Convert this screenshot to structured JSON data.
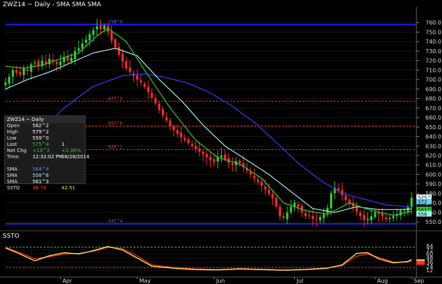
{
  "title": "ZWZ14 ~ Daily  -  SMA SMA SMA",
  "subpanel_title": "SSTO",
  "price_axis": {
    "ticks": [
      550,
      560,
      570,
      580,
      590,
      600,
      610,
      620,
      630,
      640,
      650,
      660,
      670,
      680,
      690,
      700,
      710,
      720,
      730,
      740,
      750,
      760
    ],
    "labels": [
      "550.0",
      "560.0",
      "570.0",
      "580.0",
      "590.0",
      "600.0",
      "610.0",
      "620.0",
      "630.0",
      "640.0",
      "650.0",
      "660.0",
      "670.0",
      "680.0",
      "690.0",
      "700.0",
      "710.0",
      "720.0",
      "730.0",
      "740.0",
      "750.0",
      "760.0"
    ]
  },
  "osc_axis": {
    "ticks": [
      12,
      24,
      36,
      48,
      60,
      72,
      84
    ],
    "labels": [
      "12",
      "24",
      "36",
      "48",
      "60",
      "72",
      "84"
    ]
  },
  "date_axis": {
    "labels": [
      "Apr",
      "May",
      "Jun",
      "Jul",
      "Aug",
      "Sep"
    ]
  },
  "levels": [
    {
      "value": 758,
      "label": "758^0",
      "color": "#1c1cff",
      "solid": true
    },
    {
      "value": 677.25,
      "label": "677^2",
      "color": "#ff2a2a",
      "solid": false
    },
    {
      "value": 651,
      "label": "651^6",
      "color": "#ff2a2a",
      "solid": false
    },
    {
      "value": 626.25,
      "label": "626^1",
      "color": "#ff2a2a",
      "solid": false
    },
    {
      "value": 548,
      "label": "547^4",
      "color": "#1c1cff",
      "solid": true
    }
  ],
  "price_tags": [
    {
      "label": "575^4",
      "value": 576,
      "bg": "#ffffff",
      "fg": "#000000"
    },
    {
      "label": "572",
      "value": 571.5,
      "bg": "#5ad7ff",
      "fg": "#000000"
    },
    {
      "label": "561^2",
      "value": 563,
      "bg": "#33cc33",
      "fg": "#000000"
    },
    {
      "label": "558",
      "value": 558.5,
      "bg": "#9ff3ef",
      "fg": "#000000"
    }
  ],
  "osc_levels": [
    {
      "value": 80,
      "color": "#33cc33"
    },
    {
      "value": 20,
      "color": "#ff2a2a"
    }
  ],
  "osc_tags": [
    {
      "label": "",
      "value": 38,
      "bg": "#ffe24a"
    },
    {
      "label": "",
      "value": 34,
      "bg": "#ff2a2a"
    }
  ],
  "info_box": {
    "header": "ZWZ14 ~ Daily",
    "rows": [
      {
        "label": "Open",
        "value": "562^2",
        "value_color": "w"
      },
      {
        "label": "High",
        "value": "579^2",
        "value_color": "w"
      },
      {
        "label": "Low",
        "value": "559^0",
        "value_color": "w"
      },
      {
        "label": "Last",
        "value": "575^4",
        "value_color": "g",
        "extra": "1",
        "extra_color": "w"
      },
      {
        "label": "Net Chg",
        "value": "+13^2",
        "value_color": "g",
        "extra": "+2.36%",
        "extra_color": "g"
      },
      {
        "label": "Time",
        "value": "12:32:02 PM",
        "value_color": "w",
        "extra": "08/28/2014",
        "extra_color": "w"
      },
      {
        "label": "",
        "value": "",
        "value_color": "w"
      },
      {
        "label": "SMA",
        "value": "564^4",
        "value_color": "b"
      },
      {
        "label": "SMA",
        "value": "558^6",
        "value_color": "cy"
      },
      {
        "label": "SMA",
        "value": "561^3",
        "value_color": "w"
      },
      {
        "label": "SSTO",
        "value": "38.79",
        "value_color": "r",
        "extra": "42.51",
        "extra_color": "y"
      }
    ]
  },
  "chart_data": {
    "type": "candlestick",
    "title": "ZWZ14 ~ Daily  -  SMA SMA SMA",
    "ylim": [
      545,
      770
    ],
    "colors": {
      "up": "#33cc33",
      "down": "#ff2a2a",
      "sma_fast": "#33cc33",
      "sma_mid": "#9ff3ef",
      "sma_slow": "#3a3aff",
      "ssto_k": "#ffe24a",
      "ssto_d": "#ff2a2a"
    },
    "month_positions": {
      "Apr": 15,
      "May": 36,
      "Jun": 57,
      "Jul": 79,
      "Aug": 101,
      "Sep": 123
    },
    "closes": [
      697,
      703,
      710,
      707,
      705,
      712,
      709,
      716,
      718,
      714,
      720,
      717,
      722,
      719,
      716,
      719,
      724,
      720,
      723,
      730,
      733,
      738,
      742,
      748,
      752,
      756,
      753,
      757,
      750,
      741,
      734,
      726,
      719,
      712,
      708,
      704,
      700,
      697,
      692,
      687,
      681,
      675,
      668,
      662,
      657,
      651,
      647,
      643,
      639,
      636,
      633,
      630,
      627,
      624,
      621,
      618,
      615,
      613,
      618,
      620,
      616,
      612,
      610,
      614,
      612,
      608,
      604,
      600,
      596,
      592,
      588,
      584,
      580,
      575,
      566,
      556,
      554,
      560,
      566,
      570,
      566,
      560,
      556,
      556,
      553,
      552,
      555,
      558,
      565,
      580,
      586,
      583,
      578,
      573,
      569,
      566,
      561,
      556,
      552,
      553,
      556,
      560,
      558,
      556,
      553,
      554,
      556,
      558,
      562,
      562,
      566,
      575.5
    ],
    "sma_fast_key": [
      [
        0,
        714
      ],
      [
        5,
        712
      ],
      [
        10,
        715
      ],
      [
        15,
        722
      ],
      [
        20,
        728
      ],
      [
        25,
        746
      ],
      [
        28,
        754
      ],
      [
        33,
        740
      ],
      [
        38,
        710
      ],
      [
        45,
        670
      ],
      [
        52,
        636
      ],
      [
        58,
        618
      ],
      [
        64,
        611
      ],
      [
        70,
        596
      ],
      [
        76,
        570
      ],
      [
        82,
        562
      ],
      [
        88,
        558
      ],
      [
        94,
        570
      ],
      [
        100,
        562
      ],
      [
        106,
        557
      ],
      [
        112,
        562
      ]
    ],
    "sma_mid_key": [
      [
        0,
        690
      ],
      [
        6,
        700
      ],
      [
        12,
        708
      ],
      [
        18,
        718
      ],
      [
        24,
        728
      ],
      [
        30,
        733
      ],
      [
        36,
        725
      ],
      [
        42,
        700
      ],
      [
        48,
        678
      ],
      [
        54,
        652
      ],
      [
        60,
        630
      ],
      [
        66,
        615
      ],
      [
        72,
        600
      ],
      [
        78,
        582
      ],
      [
        84,
        564
      ],
      [
        90,
        560
      ],
      [
        96,
        566
      ],
      [
        102,
        563
      ],
      [
        108,
        563
      ],
      [
        112,
        564
      ]
    ],
    "sma_slow_key": [
      [
        0,
        610
      ],
      [
        8,
        640
      ],
      [
        16,
        670
      ],
      [
        24,
        693
      ],
      [
        32,
        704
      ],
      [
        38,
        706
      ],
      [
        44,
        702
      ],
      [
        50,
        696
      ],
      [
        56,
        686
      ],
      [
        62,
        672
      ],
      [
        68,
        655
      ],
      [
        74,
        634
      ],
      [
        80,
        612
      ],
      [
        86,
        594
      ],
      [
        92,
        580
      ],
      [
        98,
        574
      ],
      [
        104,
        568
      ],
      [
        110,
        566
      ],
      [
        112,
        564.5
      ]
    ],
    "ssto_k_key": [
      [
        0,
        78
      ],
      [
        4,
        60
      ],
      [
        8,
        40
      ],
      [
        12,
        55
      ],
      [
        16,
        64
      ],
      [
        20,
        60
      ],
      [
        24,
        70
      ],
      [
        28,
        82
      ],
      [
        32,
        72
      ],
      [
        36,
        48
      ],
      [
        40,
        24
      ],
      [
        46,
        18
      ],
      [
        52,
        14
      ],
      [
        58,
        13
      ],
      [
        64,
        16
      ],
      [
        70,
        14
      ],
      [
        76,
        12
      ],
      [
        82,
        14
      ],
      [
        88,
        18
      ],
      [
        92,
        28
      ],
      [
        96,
        62
      ],
      [
        99,
        64
      ],
      [
        102,
        46
      ],
      [
        106,
        34
      ],
      [
        110,
        38
      ],
      [
        112,
        50
      ]
    ],
    "ssto_d_key": [
      [
        0,
        80
      ],
      [
        4,
        64
      ],
      [
        8,
        46
      ],
      [
        12,
        52
      ],
      [
        16,
        60
      ],
      [
        20,
        62
      ],
      [
        24,
        68
      ],
      [
        28,
        80
      ],
      [
        32,
        76
      ],
      [
        36,
        54
      ],
      [
        40,
        28
      ],
      [
        46,
        20
      ],
      [
        52,
        16
      ],
      [
        58,
        14
      ],
      [
        64,
        17
      ],
      [
        70,
        15
      ],
      [
        76,
        13
      ],
      [
        82,
        15
      ],
      [
        88,
        19
      ],
      [
        92,
        26
      ],
      [
        96,
        54
      ],
      [
        99,
        60
      ],
      [
        102,
        50
      ],
      [
        106,
        36
      ],
      [
        110,
        36
      ],
      [
        112,
        44
      ]
    ]
  }
}
